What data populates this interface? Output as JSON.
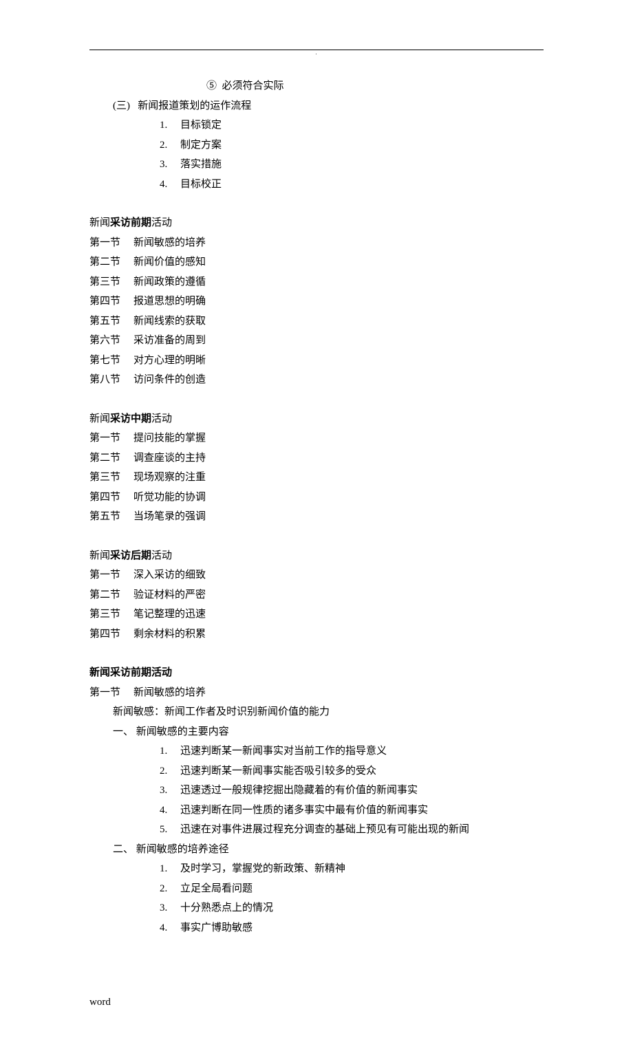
{
  "topItem5": "⑤  必须符合实际",
  "section3": {
    "heading": "(三)   新闻报道策划的运作流程",
    "items": [
      {
        "num": "1.",
        "text": "目标锁定"
      },
      {
        "num": "2.",
        "text": "制定方案"
      },
      {
        "num": "3.",
        "text": "落实措施"
      },
      {
        "num": "4.",
        "text": "目标校正"
      }
    ]
  },
  "toc": [
    {
      "title_prefix": "新闻",
      "title_bold": "采访前期",
      "title_suffix": "活动",
      "sections": [
        {
          "label": "第一节",
          "text": "新闻敏感的培养"
        },
        {
          "label": "第二节",
          "text": "新闻价值的感知"
        },
        {
          "label": "第三节",
          "text": "新闻政策的遵循"
        },
        {
          "label": "第四节",
          "text": "报道思想的明确"
        },
        {
          "label": "第五节",
          "text": "新闻线索的获取"
        },
        {
          "label": "第六节",
          "text": "采访准备的周到"
        },
        {
          "label": "第七节",
          "text": "对方心理的明晰"
        },
        {
          "label": "第八节",
          "text": "访问条件的创造"
        }
      ]
    },
    {
      "title_prefix": "新闻",
      "title_bold": "采访中期",
      "title_suffix": "活动",
      "sections": [
        {
          "label": "第一节",
          "text": "提问技能的掌握"
        },
        {
          "label": "第二节",
          "text": "调查座谈的主持"
        },
        {
          "label": "第三节",
          "text": "现场观察的注重"
        },
        {
          "label": "第四节",
          "text": "听觉功能的协调"
        },
        {
          "label": "第五节",
          "text": "当场笔录的强调"
        }
      ]
    },
    {
      "title_prefix": "新闻",
      "title_bold": "采访后期",
      "title_suffix": "活动",
      "sections": [
        {
          "label": "第一节",
          "text": "深入采访的细致"
        },
        {
          "label": "第二节",
          "text": "验证材料的严密"
        },
        {
          "label": "第三节",
          "text": "笔记整理的迅速"
        },
        {
          "label": "第四节",
          "text": "剩余材料的积累"
        }
      ]
    }
  ],
  "body": {
    "heading": "新闻采访前期活动",
    "section1": {
      "label": "第一节",
      "title": "新闻敏感的培养",
      "definition": "新闻敏感：新闻工作者及时识别新闻价值的能力",
      "sub1": {
        "heading": "一、  新闻敏感的主要内容",
        "items": [
          {
            "num": "1.",
            "text": "迅速判断某一新闻事实对当前工作的指导意义"
          },
          {
            "num": "2.",
            "text": "迅速判断某一新闻事实能否吸引较多的受众"
          },
          {
            "num": "3.",
            "text": "迅速透过一般规律挖掘出隐藏着的有价值的新闻事实"
          },
          {
            "num": "4.",
            "text": "迅速判断在同一性质的诸多事实中最有价值的新闻事实"
          },
          {
            "num": "5.",
            "text": "迅速在对事件进展过程充分调查的基础上预见有可能出现的新闻"
          }
        ]
      },
      "sub2": {
        "heading": "二、  新闻敏感的培养途径",
        "items": [
          {
            "num": "1.",
            "text": "及时学习，掌握党的新政策、新精神"
          },
          {
            "num": "2.",
            "text": "立足全局看问题"
          },
          {
            "num": "3.",
            "text": "十分熟悉点上的情况"
          },
          {
            "num": "4.",
            "text": "事实广博助敏感"
          }
        ]
      }
    }
  },
  "footer": "word"
}
